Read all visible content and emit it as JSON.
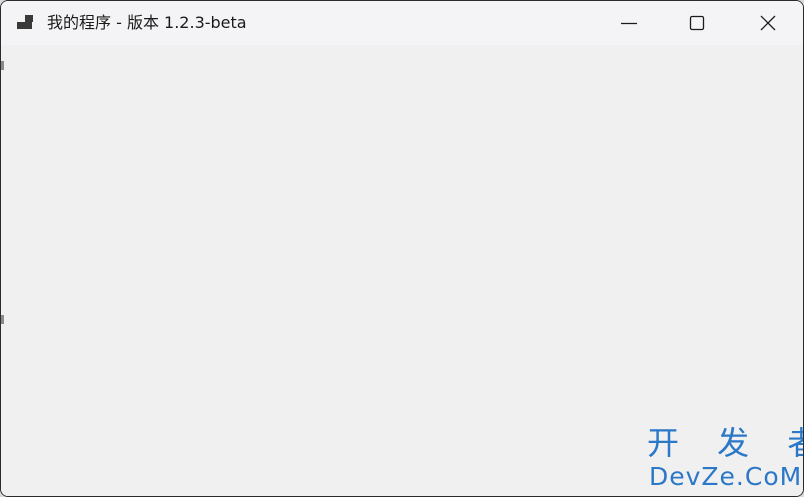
{
  "window": {
    "title": "我的程序 - 版本 1.2.3-beta",
    "icon": "window-app-icon",
    "controls": {
      "minimize_icon": "minimize-icon",
      "maximize_icon": "maximize-icon",
      "close_icon": "close-icon"
    }
  },
  "watermark": {
    "line1": "开 发 者",
    "line2": "DevZe.CoM"
  },
  "colors": {
    "titlebar_bg": "#f4f4f6",
    "client_bg": "#f0f0f0",
    "watermark": "#2b78c8"
  }
}
